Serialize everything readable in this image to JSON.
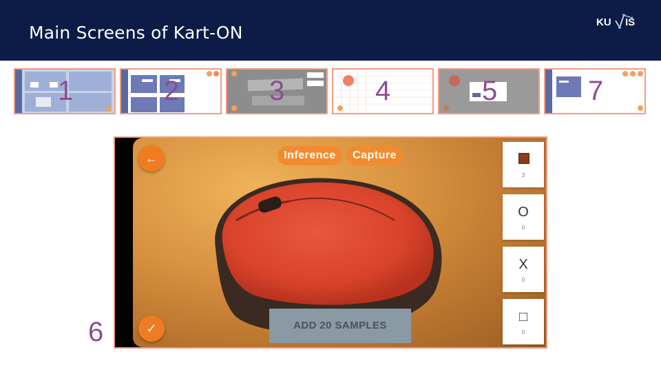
{
  "slide": {
    "title": "Main Screens of Kart-ON",
    "logo_text": "KU IS"
  },
  "thumbnails": [
    {
      "number": "1"
    },
    {
      "number": "2"
    },
    {
      "number": "3"
    },
    {
      "number": "4"
    },
    {
      "number": "5"
    },
    {
      "number": "7"
    }
  ],
  "main_screen": {
    "number": "6",
    "tabs": [
      "Inference",
      "Capture"
    ],
    "add_samples_label": "ADD 20 SAMPLES",
    "back_icon": "arrow-left-icon",
    "confirm_icon": "check-icon",
    "classes": [
      {
        "icon": "sample-image-icon",
        "count": "3"
      },
      {
        "icon": "circle-icon",
        "glyph": "O",
        "count": "0"
      },
      {
        "icon": "x-icon",
        "glyph": "X",
        "count": "0"
      },
      {
        "icon": "square-icon",
        "glyph": "□",
        "count": "0"
      }
    ]
  },
  "colors": {
    "header": "#0c1c47",
    "accent": "#f28b2f",
    "border": "#f39a84",
    "number": "#8c4d92"
  }
}
